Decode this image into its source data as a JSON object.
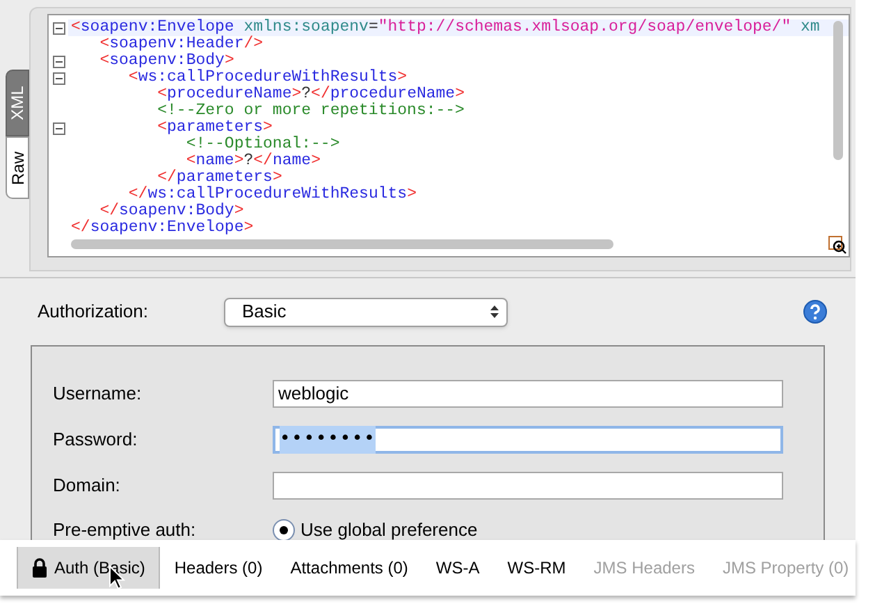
{
  "editor_tabs": [
    {
      "label": "XML",
      "selected": true
    },
    {
      "label": "Raw",
      "selected": false
    }
  ],
  "code_lines": [
    {
      "fold": true,
      "current": true,
      "tokens": [
        {
          "kind": "bracket",
          "text": "<"
        },
        {
          "kind": "tag",
          "text": "soapenv:Envelope"
        },
        {
          "kind": "attr",
          "text": " xmlns:soapenv"
        },
        {
          "kind": "text",
          "text": "="
        },
        {
          "kind": "value",
          "text": "\"http://schemas.xmlsoap.org/soap/envelope/\""
        },
        {
          "kind": "attr",
          "text": " xm"
        }
      ]
    },
    {
      "fold": false,
      "current": false,
      "tokens": [
        {
          "kind": "bracket",
          "text": "   <"
        },
        {
          "kind": "tag",
          "text": "soapenv:Header"
        },
        {
          "kind": "bracket",
          "text": "/>"
        }
      ]
    },
    {
      "fold": true,
      "current": false,
      "tokens": [
        {
          "kind": "bracket",
          "text": "   <"
        },
        {
          "kind": "tag",
          "text": "soapenv:Body"
        },
        {
          "kind": "bracket",
          "text": ">"
        }
      ]
    },
    {
      "fold": true,
      "current": false,
      "tokens": [
        {
          "kind": "bracket",
          "text": "      <"
        },
        {
          "kind": "tag",
          "text": "ws:callProcedureWithResults"
        },
        {
          "kind": "bracket",
          "text": ">"
        }
      ]
    },
    {
      "fold": false,
      "current": false,
      "tokens": [
        {
          "kind": "bracket",
          "text": "         <"
        },
        {
          "kind": "tag",
          "text": "procedureName"
        },
        {
          "kind": "bracket",
          "text": ">"
        },
        {
          "kind": "text",
          "text": "?"
        },
        {
          "kind": "bracket",
          "text": "</"
        },
        {
          "kind": "tag",
          "text": "procedureName"
        },
        {
          "kind": "bracket",
          "text": ">"
        }
      ]
    },
    {
      "fold": false,
      "current": false,
      "tokens": [
        {
          "kind": "comment",
          "text": "         <!--Zero or more repetitions:-->"
        }
      ]
    },
    {
      "fold": true,
      "current": false,
      "tokens": [
        {
          "kind": "bracket",
          "text": "         <"
        },
        {
          "kind": "tag",
          "text": "parameters"
        },
        {
          "kind": "bracket",
          "text": ">"
        }
      ]
    },
    {
      "fold": false,
      "current": false,
      "tokens": [
        {
          "kind": "comment",
          "text": "            <!--Optional:-->"
        }
      ]
    },
    {
      "fold": false,
      "current": false,
      "tokens": [
        {
          "kind": "bracket",
          "text": "            <"
        },
        {
          "kind": "tag",
          "text": "name"
        },
        {
          "kind": "bracket",
          "text": ">"
        },
        {
          "kind": "text",
          "text": "?"
        },
        {
          "kind": "bracket",
          "text": "</"
        },
        {
          "kind": "tag",
          "text": "name"
        },
        {
          "kind": "bracket",
          "text": ">"
        }
      ]
    },
    {
      "fold": false,
      "current": false,
      "tokens": [
        {
          "kind": "bracket",
          "text": "         </"
        },
        {
          "kind": "tag",
          "text": "parameters"
        },
        {
          "kind": "bracket",
          "text": ">"
        }
      ]
    },
    {
      "fold": false,
      "current": false,
      "tokens": [
        {
          "kind": "bracket",
          "text": "      </"
        },
        {
          "kind": "tag",
          "text": "ws:callProcedureWithResults"
        },
        {
          "kind": "bracket",
          "text": ">"
        }
      ]
    },
    {
      "fold": false,
      "current": false,
      "tokens": [
        {
          "kind": "bracket",
          "text": "   </"
        },
        {
          "kind": "tag",
          "text": "soapenv:Body"
        },
        {
          "kind": "bracket",
          "text": ">"
        }
      ]
    },
    {
      "fold": false,
      "current": false,
      "tokens": [
        {
          "kind": "bracket",
          "text": "</"
        },
        {
          "kind": "tag",
          "text": "soapenv:Envelope"
        },
        {
          "kind": "bracket",
          "text": ">"
        }
      ]
    }
  ],
  "authorization": {
    "label": "Authorization:",
    "value": "Basic"
  },
  "fields": [
    {
      "label": "Username:",
      "value": "weblogic",
      "kind": "text",
      "focused": false
    },
    {
      "label": "Password:",
      "value": "••••••••",
      "kind": "password",
      "focused": true
    },
    {
      "label": "Domain:",
      "kind": "text",
      "focused": false
    }
  ],
  "preemptive": {
    "label": "Pre-emptive auth:",
    "option": "Use global preference",
    "selected": true
  },
  "bottom_tabs": [
    {
      "label": "Auth (Basic)",
      "selected": true,
      "disabled": false,
      "kind": "lock"
    },
    {
      "label": "Headers (0)",
      "selected": false,
      "disabled": false
    },
    {
      "label": "Attachments (0)",
      "selected": false,
      "disabled": false
    },
    {
      "label": "WS-A",
      "selected": false,
      "disabled": false
    },
    {
      "label": "WS-RM",
      "selected": false,
      "disabled": false
    },
    {
      "label": "JMS Headers",
      "selected": false,
      "disabled": true
    },
    {
      "label": "JMS Property (0)",
      "selected": false,
      "disabled": true
    }
  ]
}
